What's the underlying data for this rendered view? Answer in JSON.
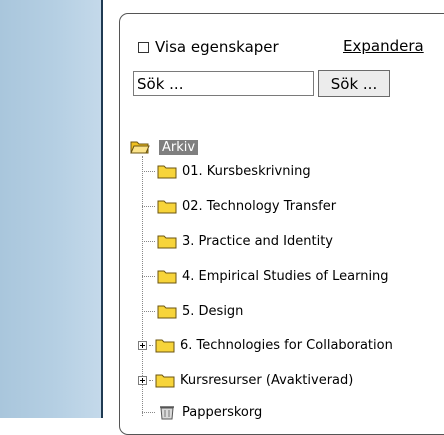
{
  "options": {
    "show_properties_label": "Visa egenskaper",
    "show_properties_checked": false,
    "expand_label": "Expandera"
  },
  "search": {
    "value": "Sök ...",
    "button_label": "Sök ..."
  },
  "tree": {
    "root": {
      "label": "Arkiv",
      "icon": "folder-open-icon",
      "selected": true
    },
    "items": [
      {
        "label": "01. Kursbeskrivning",
        "icon": "folder-icon"
      },
      {
        "label": "02. Technology Transfer",
        "icon": "folder-icon"
      },
      {
        "label": "3. Practice and Identity",
        "icon": "folder-icon"
      },
      {
        "label": "4. Empirical Studies of Learning",
        "icon": "folder-icon"
      },
      {
        "label": "5. Design",
        "icon": "folder-icon"
      },
      {
        "label": "6. Technologies for Collaboration",
        "icon": "folder-icon",
        "expandable": true
      },
      {
        "label": "Kursresurser (Avaktiverad)",
        "icon": "folder-icon",
        "expandable": true
      },
      {
        "label": "Papperskorg",
        "icon": "recycle-bin-icon"
      }
    ]
  },
  "colors": {
    "left_strip": "#b5cfe3",
    "folder_yellow": "#f7d43a",
    "selection_gray": "#7f7f7f"
  }
}
